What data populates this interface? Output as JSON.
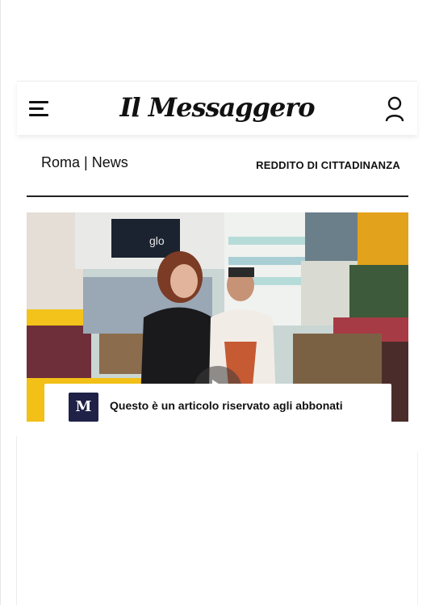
{
  "header": {
    "logo": "Il Messaggero",
    "menu_icon": "hamburger-menu-icon",
    "account_icon": "user-account-icon"
  },
  "subnav": {
    "section": "Roma | News",
    "topic": "REDDITO DI CITTADINANZA"
  },
  "article": {
    "video_icon": "play-icon",
    "paywall": {
      "badge": "M",
      "text": "Questo è un articolo riservato agli abbonati"
    }
  },
  "colors": {
    "badge_bg": "#1f2147",
    "text": "#111111"
  }
}
